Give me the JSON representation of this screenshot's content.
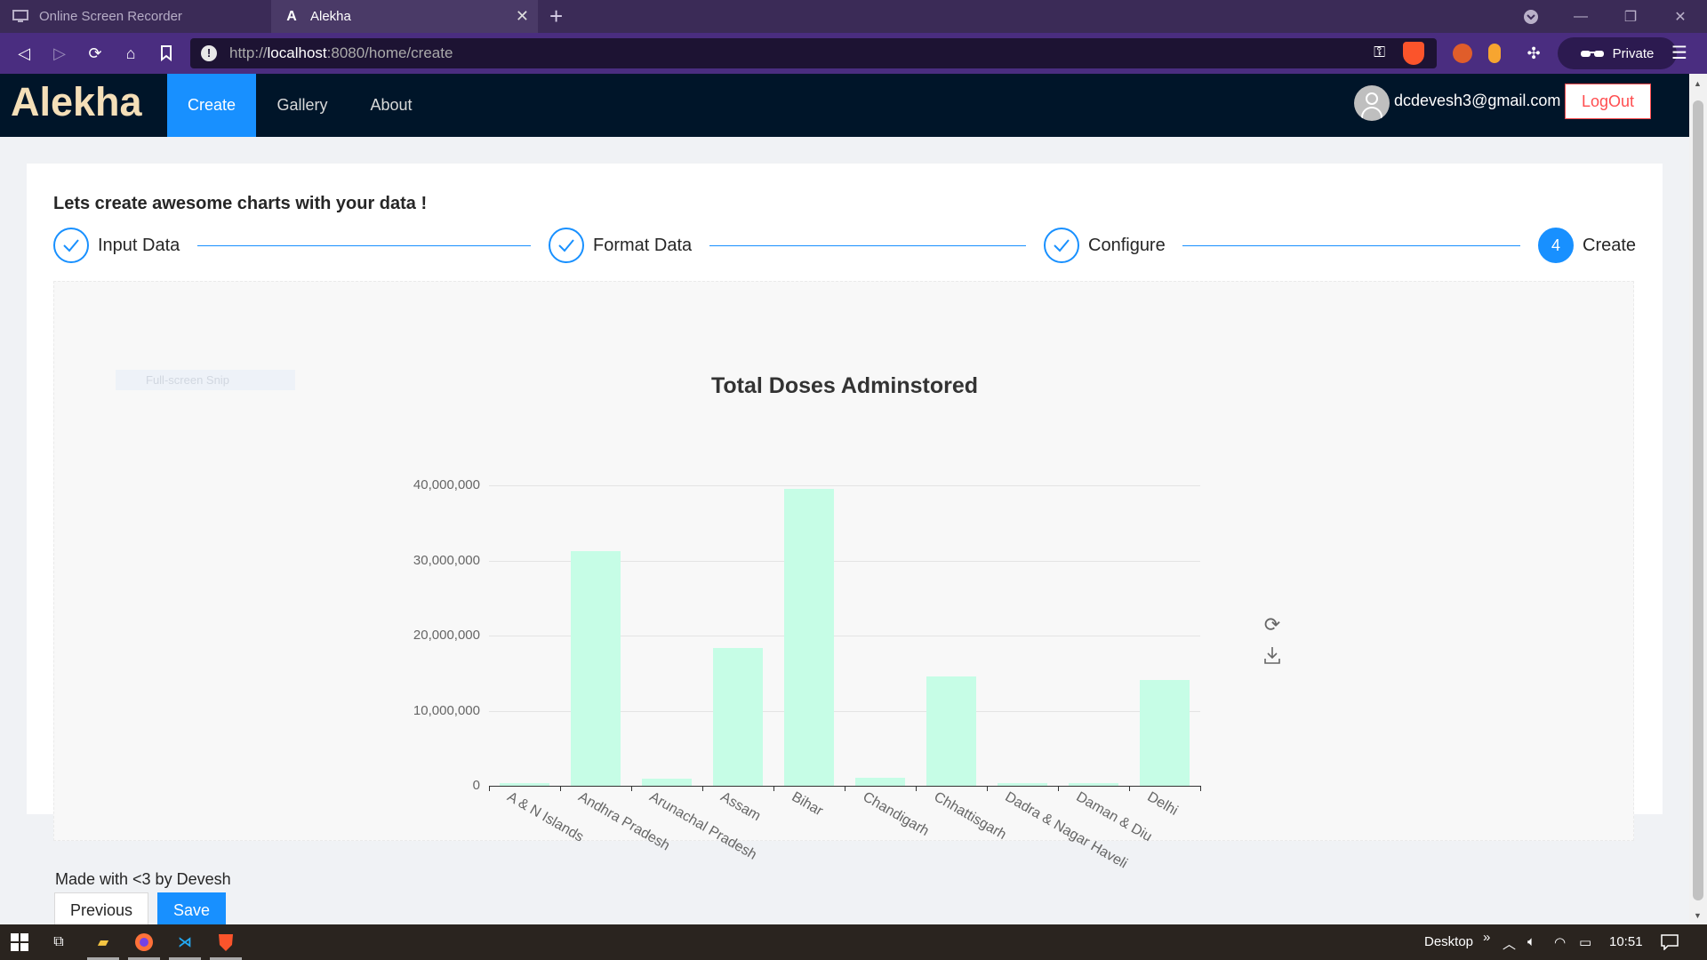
{
  "browser": {
    "tabs": [
      {
        "title": "Online Screen Recorder",
        "active": false
      },
      {
        "title": "Alekha",
        "active": true
      }
    ],
    "url_host": "localhost",
    "url_prefix": "http://",
    "url_rest": ":8080/home/create",
    "private_label": "Private"
  },
  "app": {
    "logo": "Alekha",
    "nav": [
      "Create",
      "Gallery",
      "About"
    ],
    "user_email": "dcdevesh3@gmail.com",
    "logout_label": "LogOut"
  },
  "page": {
    "intro": "Lets create awesome charts with your data !",
    "steps": [
      {
        "label": "Input Data",
        "status": "done"
      },
      {
        "label": "Format Data",
        "status": "done"
      },
      {
        "label": "Configure",
        "status": "done"
      },
      {
        "label": "Create",
        "status": "current",
        "number": "4"
      }
    ],
    "snip_tooltip": "Full-screen Snip",
    "footer_text": "Made with <3 by Devesh",
    "prev_label": "Previous",
    "save_label": "Save"
  },
  "chart_data": {
    "type": "bar",
    "title": "Total Doses Adminstored",
    "categories": [
      "A & N Islands",
      "Andhra Pradesh",
      "Arunachal Pradesh",
      "Assam",
      "Bihar",
      "Chandigarh",
      "Chhattisgarh",
      "Dadra & Nagar Haveli",
      "Daman & Diu",
      "Delhi"
    ],
    "values": [
      400000,
      31200000,
      1000000,
      18400000,
      39500000,
      1100000,
      14500000,
      400000,
      300000,
      14100000
    ],
    "ylim": [
      0,
      40000000
    ],
    "yticks": [
      "0",
      "10,000,000",
      "20,000,000",
      "30,000,000",
      "40,000,000"
    ],
    "grid": true,
    "bar_color": "#c6fde6"
  },
  "taskbar": {
    "desktop_label": "Desktop",
    "time": "10:51"
  }
}
